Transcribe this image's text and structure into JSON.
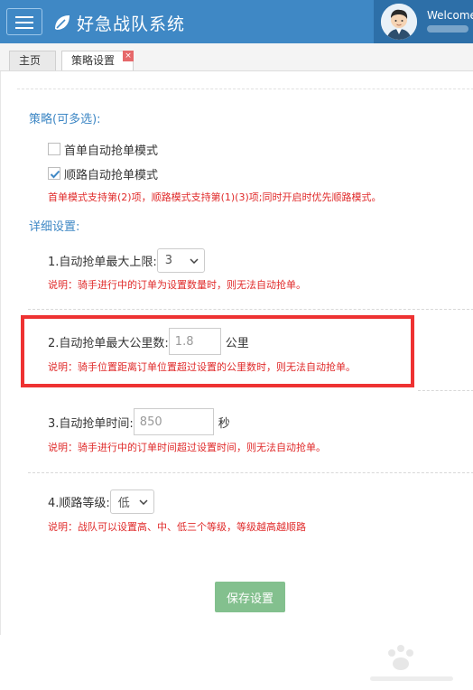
{
  "header": {
    "app_title": "好急战队系统",
    "welcome": "Welcome",
    "brand_color": "#3f88c5"
  },
  "tabs": [
    {
      "label": "主页",
      "active": false
    },
    {
      "label": "策略设置",
      "active": true,
      "close": "×"
    }
  ],
  "strategy": {
    "title": "策略(可多选):",
    "options": [
      {
        "label": "首单自动抢单模式",
        "checked": false
      },
      {
        "label": "顺路自动抢单模式",
        "checked": true
      }
    ],
    "note": "首单模式支持第(2)项，顺路模式支持第(1)(3)项;同时开启时优先顺路模式。"
  },
  "details": {
    "title": "详细设置:",
    "max_orders": {
      "label": "1.自动抢单最大上限:",
      "value": "3",
      "note": "说明：骑手进行中的订单为设置数量时，则无法自动抢单。"
    },
    "max_distance": {
      "label": "2.自动抢单最大公里数:",
      "value": "1.8",
      "unit": "公里",
      "note": "说明：骑手位置距离订单位置超过设置的公里数时，则无法自动抢单。"
    },
    "grab_time": {
      "label": "3.自动抢单时间:",
      "value": "850",
      "unit": "秒",
      "note": "说明：骑手进行中的订单时间超过设置时间，则无法自动抢单。"
    },
    "route_level": {
      "label": "4.顺路等级:",
      "value": "低",
      "note": "说明：战队可以设置高、中、低三个等级，等级越高越顺路"
    }
  },
  "save_label": "保存设置",
  "colors": {
    "note_red": "#e02b2b",
    "highlight": "#ee3232",
    "save_green": "#83c08e"
  }
}
